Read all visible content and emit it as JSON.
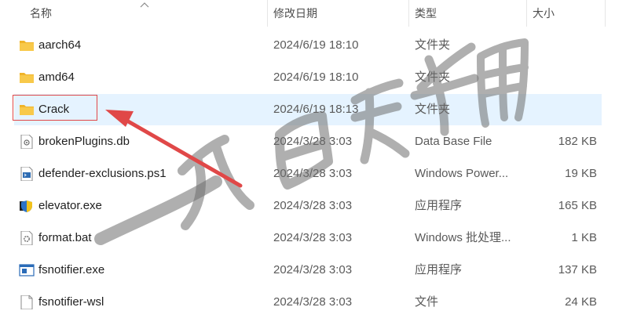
{
  "header": {
    "col_name": "名称",
    "col_date": "修改日期",
    "col_type": "类型",
    "col_size": "大小"
  },
  "files": [
    {
      "name": "aarch64",
      "date": "2024/6/19 18:10",
      "type": "文件夹",
      "size": "",
      "icon": "folder-icon"
    },
    {
      "name": "amd64",
      "date": "2024/6/19 18:10",
      "type": "文件夹",
      "size": "",
      "icon": "folder-icon"
    },
    {
      "name": "Crack",
      "date": "2024/6/19 18:13",
      "type": "文件夹",
      "size": "",
      "icon": "folder-icon"
    },
    {
      "name": "brokenPlugins.db",
      "date": "2024/3/28 3:03",
      "type": "Data Base File",
      "size": "182 KB",
      "icon": "database-file-icon"
    },
    {
      "name": "defender-exclusions.ps1",
      "date": "2024/3/28 3:03",
      "type": "Windows Power...",
      "size": "19 KB",
      "icon": "powershell-script-icon"
    },
    {
      "name": "elevator.exe",
      "date": "2024/3/28 3:03",
      "type": "应用程序",
      "size": "165 KB",
      "icon": "app-shield-icon"
    },
    {
      "name": "format.bat",
      "date": "2024/3/28 3:03",
      "type": "Windows 批处理...",
      "size": "1 KB",
      "icon": "batch-file-icon"
    },
    {
      "name": "fsnotifier.exe",
      "date": "2024/3/28 3:03",
      "type": "应用程序",
      "size": "137 KB",
      "icon": "app-window-icon"
    },
    {
      "name": "fsnotifier-wsl",
      "date": "2024/3/28 3:03",
      "type": "文件",
      "size": "24 KB",
      "icon": "file-icon"
    }
  ],
  "colors": {
    "selected_row": "#e5f3ff",
    "highlight_box": "#e04848",
    "arrow": "#e04848",
    "folder": "#f8c94a"
  }
}
